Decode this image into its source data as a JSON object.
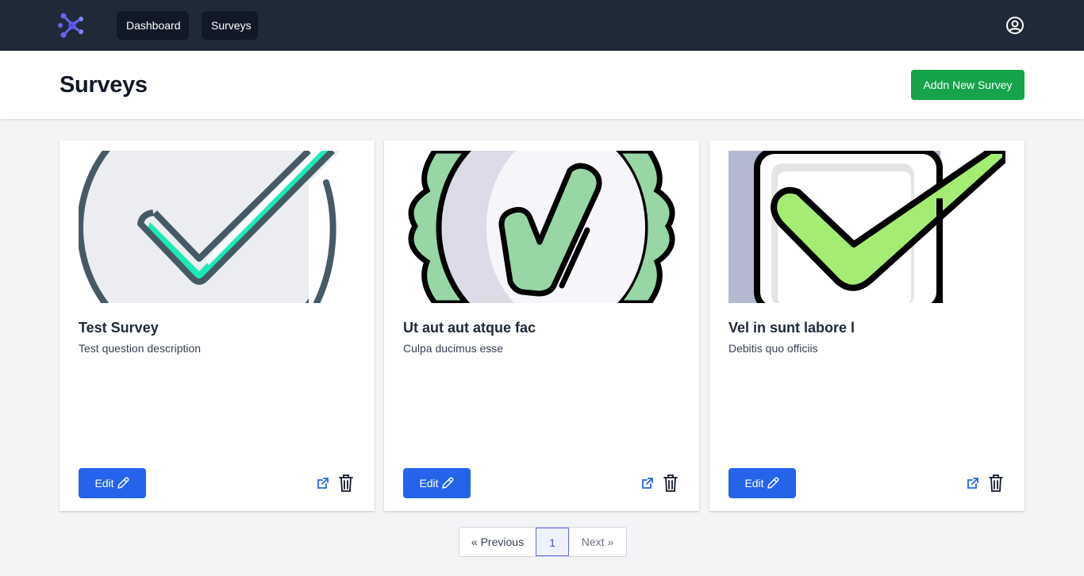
{
  "nav": {
    "logo_icon": "molecule-logo-icon",
    "links": [
      {
        "label": "Dashboard"
      },
      {
        "label": "Surveys"
      }
    ],
    "user_icon": "user-circle-icon"
  },
  "header": {
    "title": "Surveys",
    "add_button_label": "Addn New Survey"
  },
  "cards": [
    {
      "title": "Test Survey",
      "description": "Test question description",
      "edit_label": "Edit",
      "image_icon": "checkmark-circle-icon"
    },
    {
      "title": "Ut aut aut atque fac",
      "description": "Culpa ducimus esse",
      "edit_label": "Edit",
      "image_icon": "checkmark-badge-icon"
    },
    {
      "title": "Vel in sunt labore l",
      "description": "Debitis quo officiis",
      "edit_label": "Edit",
      "image_icon": "checkbox-checked-icon"
    }
  ],
  "pagination": {
    "previous_label": "« Previous",
    "current_page": "1",
    "next_label": "Next »"
  },
  "colors": {
    "navbar": "#1f2937",
    "primary": "#2563eb",
    "success": "#16a34a",
    "logo": "#6366f1"
  }
}
